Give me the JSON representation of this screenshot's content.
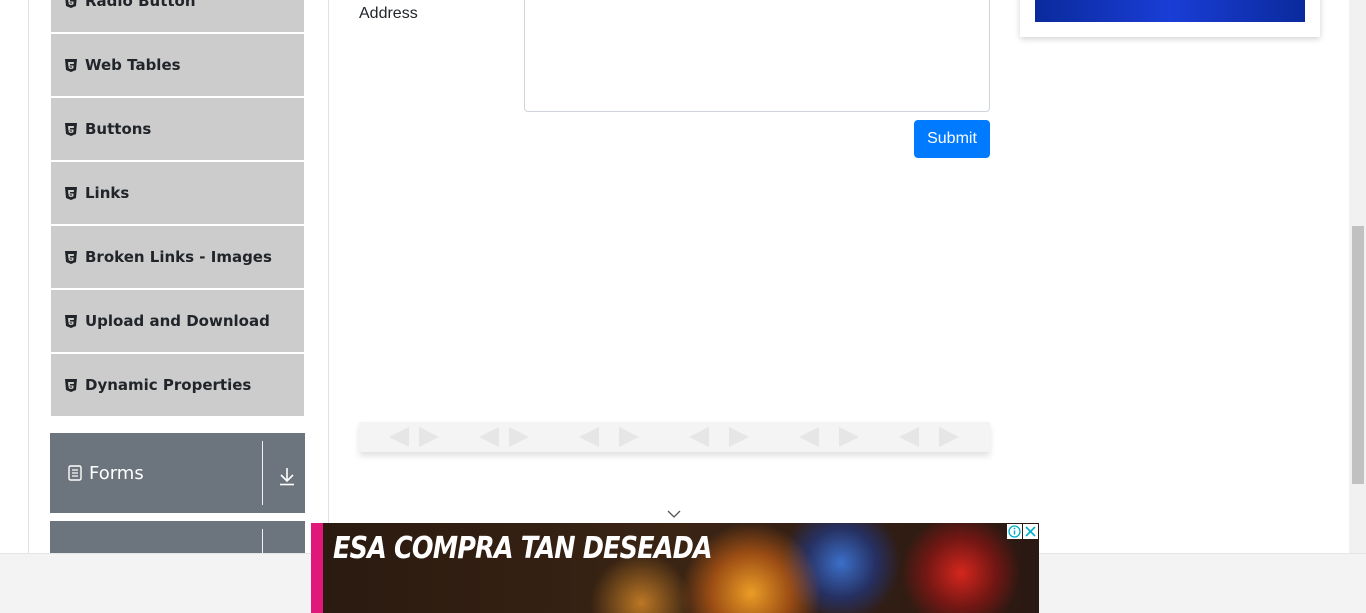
{
  "sidebar": {
    "items": [
      {
        "label": "Radio Button"
      },
      {
        "label": "Web Tables"
      },
      {
        "label": "Buttons"
      },
      {
        "label": "Links"
      },
      {
        "label": "Broken Links - Images"
      },
      {
        "label": "Upload and Download"
      },
      {
        "label": "Dynamic Properties"
      }
    ],
    "groups": [
      {
        "label": "Forms"
      },
      {
        "label": ""
      }
    ]
  },
  "form": {
    "address_label": "Address",
    "address_value": "",
    "submit_label": "Submit"
  },
  "ad": {
    "headline": "ESA COMPRA TAN DESEADA"
  },
  "colors": {
    "sidebar_item_bg": "#cccccc",
    "group_bg": "#6c757d",
    "primary": "#007bff",
    "ad_stripe": "#e0187a"
  }
}
